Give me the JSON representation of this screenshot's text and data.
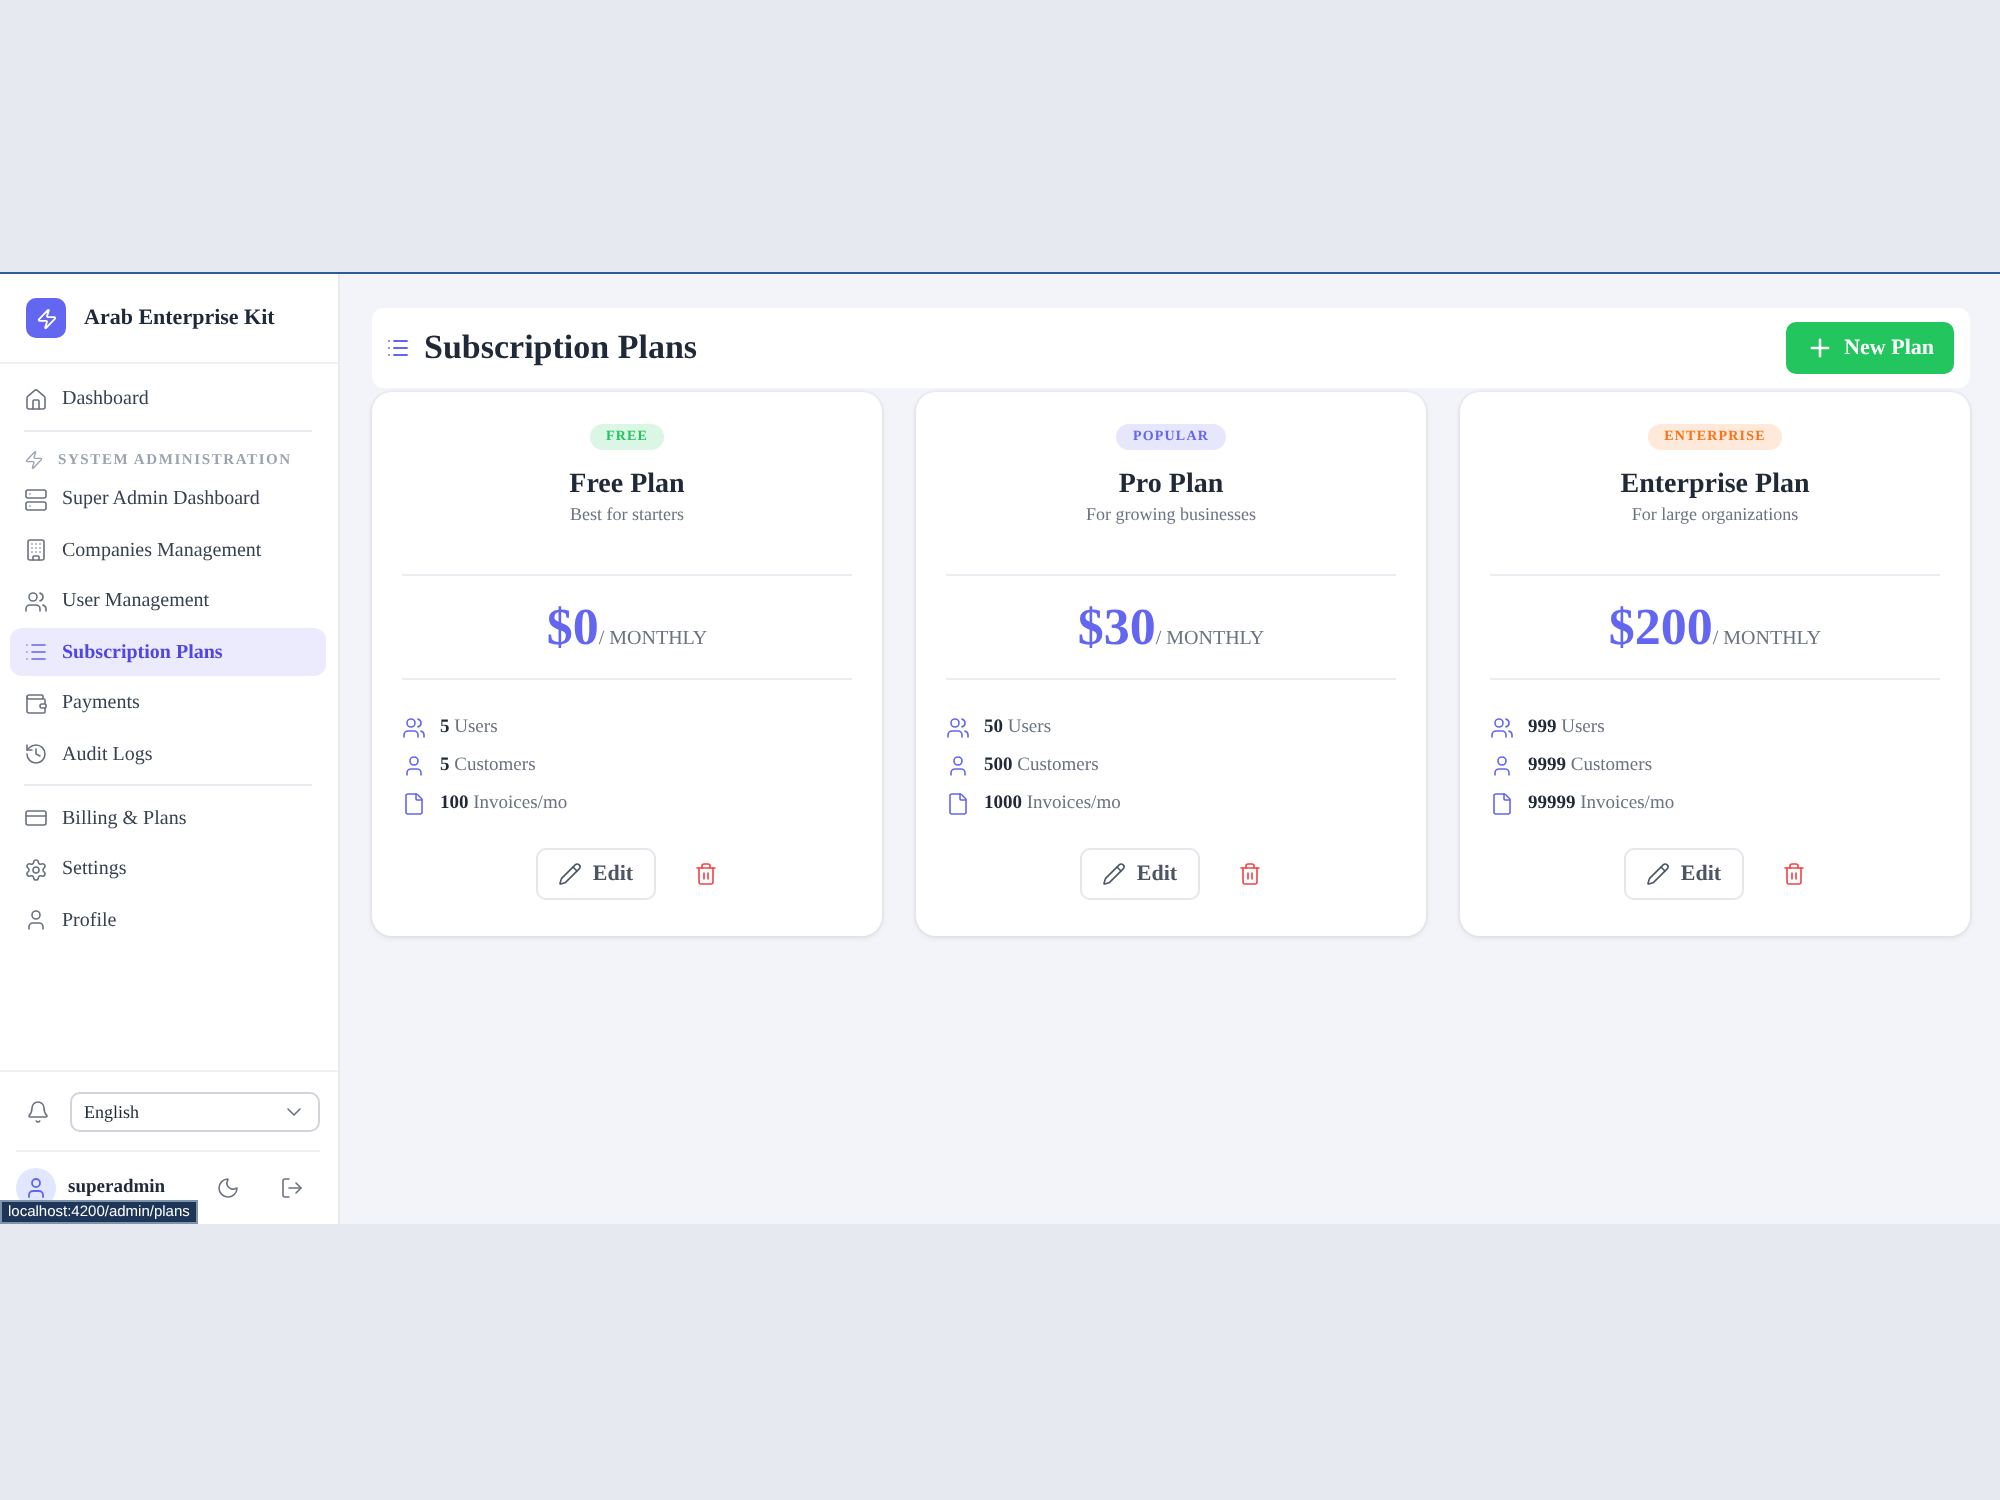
{
  "sidebar": {
    "brand": "Arab Enterprise Kit",
    "groups": [
      {
        "items": [
          {
            "kind": "home",
            "label": "Dashboard",
            "selected": false
          }
        ]
      },
      {
        "heading": "SYSTEM ADMINISTRATION",
        "items": [
          {
            "kind": "server",
            "label": "Super Admin Dashboard",
            "selected": false
          },
          {
            "kind": "building",
            "label": "Companies Management",
            "selected": false
          },
          {
            "kind": "users",
            "label": "User Management",
            "selected": false
          },
          {
            "kind": "list",
            "label": "Subscription Plans",
            "selected": true
          },
          {
            "kind": "wallet",
            "label": "Payments",
            "selected": false
          },
          {
            "kind": "history",
            "label": "Audit Logs",
            "selected": false
          }
        ]
      },
      {
        "items": [
          {
            "kind": "card",
            "label": "Billing & Plans",
            "selected": false
          },
          {
            "kind": "settings",
            "label": "Settings",
            "selected": false
          },
          {
            "kind": "user",
            "label": "Profile",
            "selected": false
          }
        ]
      }
    ],
    "language": "English",
    "user": "superadmin"
  },
  "header": {
    "title": "Subscription Plans",
    "button": "New Plan"
  },
  "plans": [
    {
      "badge": "FREE",
      "color": "#22c55e",
      "name": "Free Plan",
      "description": "Best for starters",
      "price": "$0",
      "period": "/ MONTHLY",
      "features": [
        {
          "kind": "users",
          "text": "**5** Users"
        },
        {
          "kind": "customers",
          "text": "**5** Customers"
        },
        {
          "kind": "invoices",
          "text": "**100** Invoices/mo"
        }
      ],
      "edit": "Edit"
    },
    {
      "badge": "POPULAR",
      "color": "#6366f1",
      "name": "Pro Plan",
      "description": "For growing businesses",
      "price": "$30",
      "period": "/ MONTHLY",
      "features": [
        {
          "kind": "users",
          "text": "**50** Users"
        },
        {
          "kind": "customers",
          "text": "**500** Customers"
        },
        {
          "kind": "invoices",
          "text": "**1000** Invoices/mo"
        }
      ],
      "edit": "Edit"
    },
    {
      "badge": "ENTERPRISE",
      "color": "#f97316",
      "name": "Enterprise Plan",
      "description": "For large organizations",
      "price": "$200",
      "period": "/ MONTHLY",
      "features": [
        {
          "kind": "users",
          "text": "**999** Users"
        },
        {
          "kind": "customers",
          "text": "**9999** Customers"
        },
        {
          "kind": "invoices",
          "text": "**99999** Invoices/mo"
        }
      ],
      "edit": "Edit"
    }
  ],
  "status_url": "localhost:4200/admin/plans"
}
